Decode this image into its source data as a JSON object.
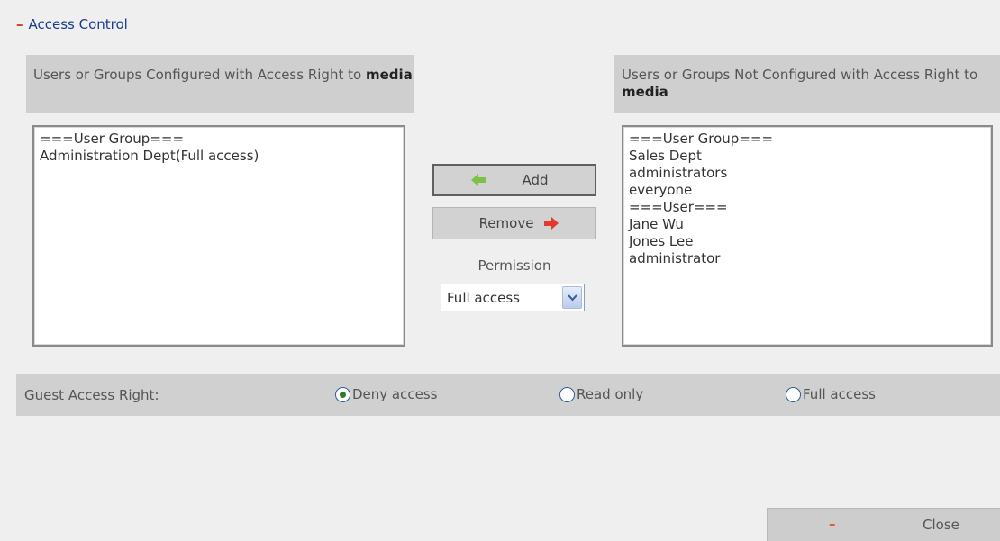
{
  "section": {
    "toggle": "–",
    "title": "Access Control"
  },
  "configured_panel": {
    "title_prefix": "Users or Groups Configured with Access Right to ",
    "folder_name": "media",
    "items": [
      "===User Group===",
      "Administration Dept(Full access)"
    ]
  },
  "not_configured_panel": {
    "title_prefix": "Users or Groups Not Configured with Access Right to ",
    "folder_name": "media",
    "items": [
      "===User Group===",
      "Sales Dept",
      "administrators",
      "everyone",
      "===User===",
      "Jane Wu",
      "Jones Lee",
      "administrator"
    ]
  },
  "actions": {
    "add_label": "Add",
    "remove_label": "Remove",
    "permission_label": "Permission",
    "permission_value": "Full access",
    "add_arrow_color": "#7cc24a",
    "remove_arrow_color": "#e23b2e"
  },
  "guest": {
    "label": "Guest Access Right:",
    "options": [
      {
        "label": "Deny access",
        "checked": true
      },
      {
        "label": "Read only",
        "checked": false
      },
      {
        "label": "Full access",
        "checked": false
      }
    ]
  },
  "footer": {
    "close_icon": "–",
    "close_label": "Close"
  }
}
